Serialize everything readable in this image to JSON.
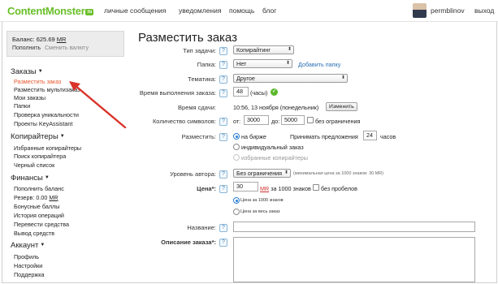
{
  "header": {
    "logo_text": "ContentMonster",
    "logo_suffix": "ru",
    "nav": [
      "личные сообщения",
      "уведомления",
      "помощь",
      "блог"
    ],
    "username": "permblinov",
    "logout": "выход"
  },
  "balance": {
    "label": "Баланс:",
    "value": "625.69",
    "currency": "MR",
    "refill": "Пополнить",
    "change_currency": "Сменить валюту"
  },
  "sidebar": {
    "orders": {
      "title": "Заказы",
      "items": [
        "Разместить заказ",
        "Разместить мультизаказ",
        "Мои заказы",
        "Папки",
        "Проверка уникальности",
        "Проекты KeyAssistant"
      ]
    },
    "copywriters": {
      "title": "Копирайтеры",
      "items": [
        "Избранные копирайтеры",
        "Поиск копирайтера",
        "Черный список"
      ]
    },
    "finance": {
      "title": "Финансы",
      "items": [
        "Пополнить баланс",
        "Резерв:",
        "Бонусные баллы",
        "История операций",
        "Перевести средства",
        "Вывод средств"
      ],
      "reserve_value": "0.00",
      "reserve_currency": "MR"
    },
    "account": {
      "title": "Аккаунт",
      "items": [
        "Профиль",
        "Настройки",
        "Поддержка"
      ]
    }
  },
  "form": {
    "title": "Разместить заказ",
    "task_type": {
      "label": "Тип задачи:",
      "value": "Копирайтинг"
    },
    "folder": {
      "label": "Папка:",
      "value": "Нет",
      "add_link": "Добавить папку"
    },
    "topic": {
      "label": "Тематика:",
      "value": "Другое"
    },
    "duration": {
      "label": "Время выполнения заказа:",
      "value": "48",
      "unit": "(часы)"
    },
    "deadline": {
      "label": "Время сдачи:",
      "value": "10:56, 13 ноября (понедельник)",
      "change_button": "Изменить"
    },
    "chars": {
      "label": "Количество символов:",
      "from_label": "от:",
      "from_value": "3000",
      "to_label": "до:",
      "to_value": "5000",
      "no_limit": "без ограничения"
    },
    "placement": {
      "label": "Разместить:",
      "options": [
        "на бирже",
        "индивидуальный заказ",
        "избранные копирайтеры"
      ],
      "accept_label": "Принимать предложения",
      "accept_value": "24",
      "accept_unit": "часов"
    },
    "author_level": {
      "label": "Уровень автора:",
      "value": "Без ограничения",
      "note": "(минимальная цена за 1000 знаков: 30 MR)"
    },
    "price": {
      "label": "Цена*:",
      "value": "30",
      "currency": "MR",
      "per": "за 1000 знаков",
      "no_spaces": "без пробелов",
      "options": [
        "Цена за 1000 знаков",
        "Цена за весь заказ"
      ]
    },
    "name": {
      "label": "Название:"
    },
    "description": {
      "label": "Описание заказа*:"
    }
  },
  "colors": {
    "brand_green": "#6abf2a",
    "active_link": "#e8542a",
    "arrow_red": "#d9332b",
    "link_blue": "#2a6fb5"
  }
}
